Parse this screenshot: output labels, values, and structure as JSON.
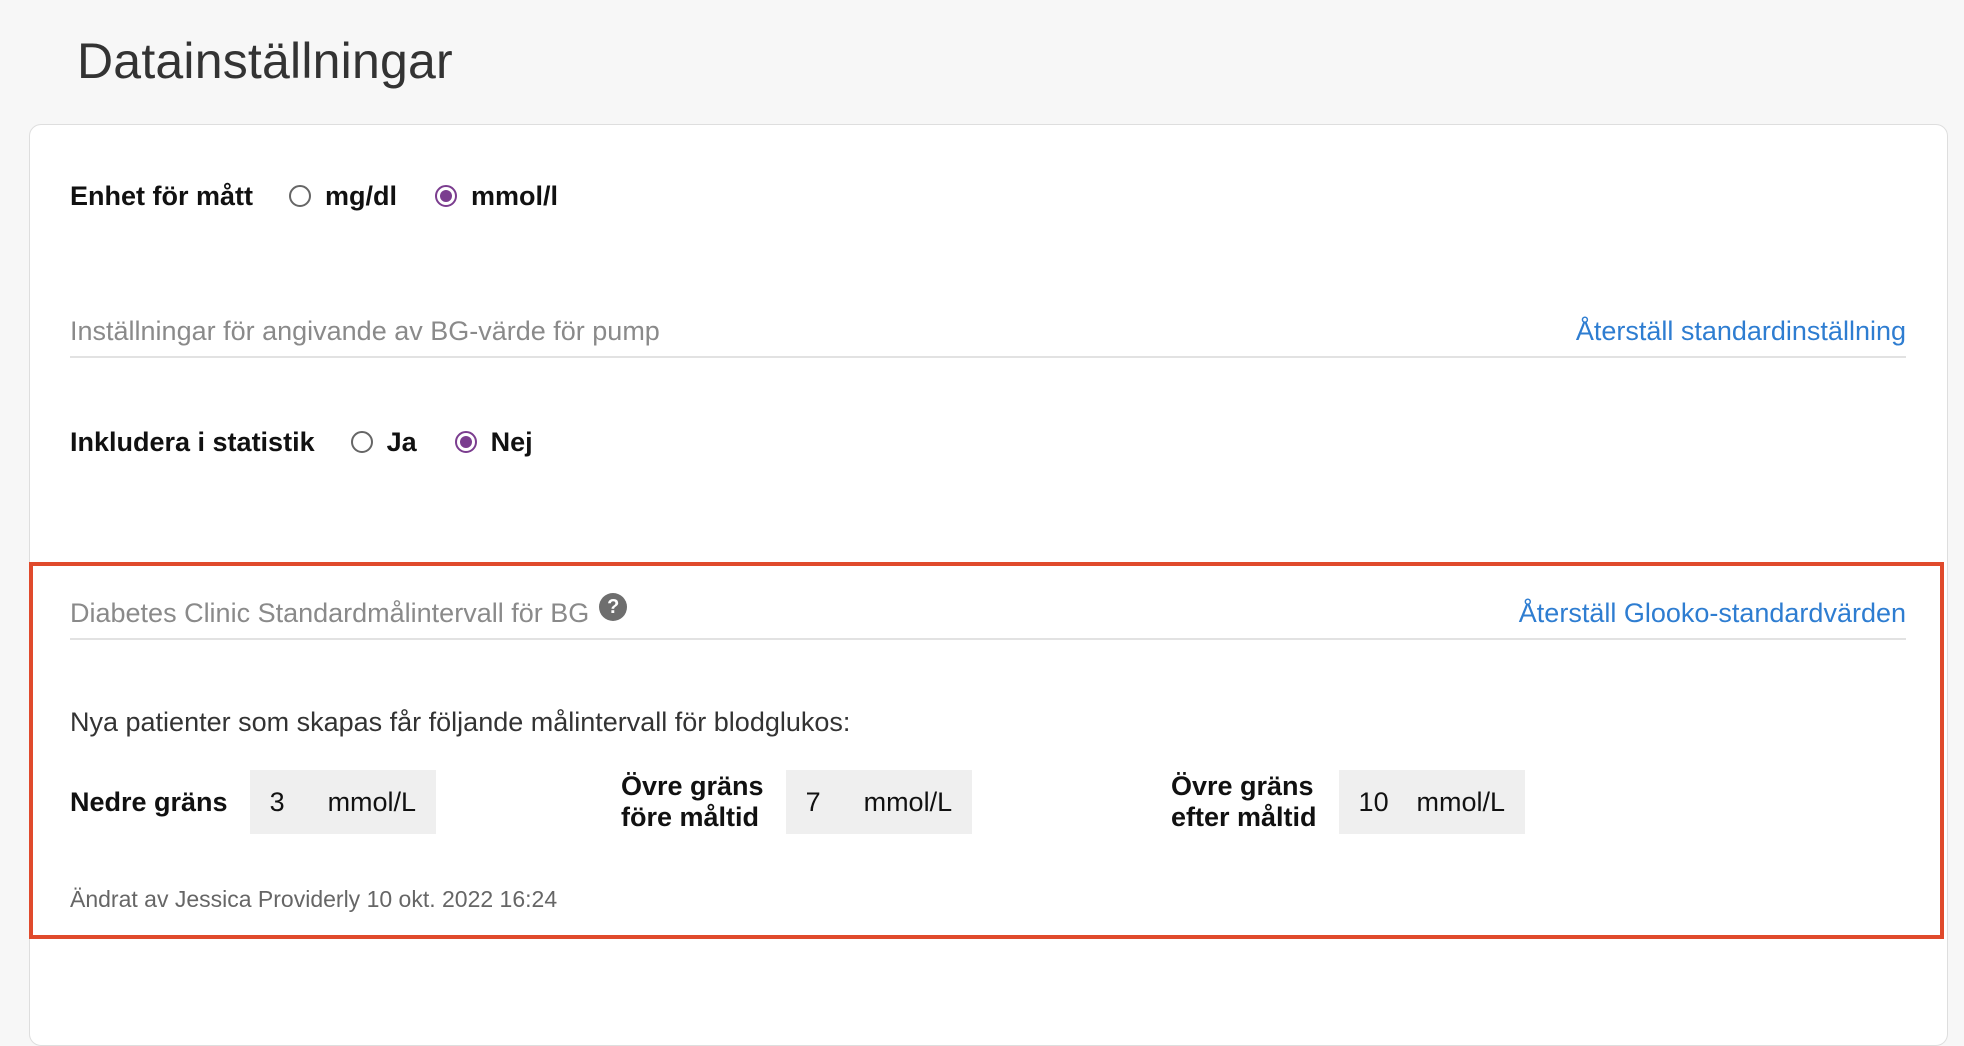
{
  "page": {
    "title": "Datainställningar"
  },
  "unit_setting": {
    "label": "Enhet för mått",
    "options": [
      {
        "label": "mg/dl",
        "selected": false
      },
      {
        "label": "mmol/l",
        "selected": true
      }
    ]
  },
  "pump_section": {
    "title": "Inställningar för angivande av BG-värde för pump",
    "reset_link": "Återställ standardinställning"
  },
  "statistics": {
    "label": "Inkludera i statistik",
    "options": [
      {
        "label": "Ja",
        "selected": false
      },
      {
        "label": "Nej",
        "selected": true
      }
    ]
  },
  "target_section": {
    "title": "Diabetes Clinic Standardmålintervall för BG",
    "help_icon": "?",
    "reset_link": "Återställ Glooko-standardvärden",
    "description": "Nya patienter som skapas får följande målintervall för blodglukos:",
    "lower": {
      "label": "Nedre gräns",
      "value": "3",
      "unit": "mmol/L"
    },
    "upper_before": {
      "label_line1": "Övre gräns",
      "label_line2": "före måltid",
      "value": "7",
      "unit": "mmol/L"
    },
    "upper_after": {
      "label_line1": "Övre gräns",
      "label_line2": "efter måltid",
      "value": "10",
      "unit": "mmol/L"
    },
    "modified": "Ändrat av Jessica Providerly 10 okt. 2022 16:24"
  },
  "colors": {
    "accent": "#7b3d8f",
    "link": "#2e7dd1",
    "highlight": "#e04a2c"
  }
}
